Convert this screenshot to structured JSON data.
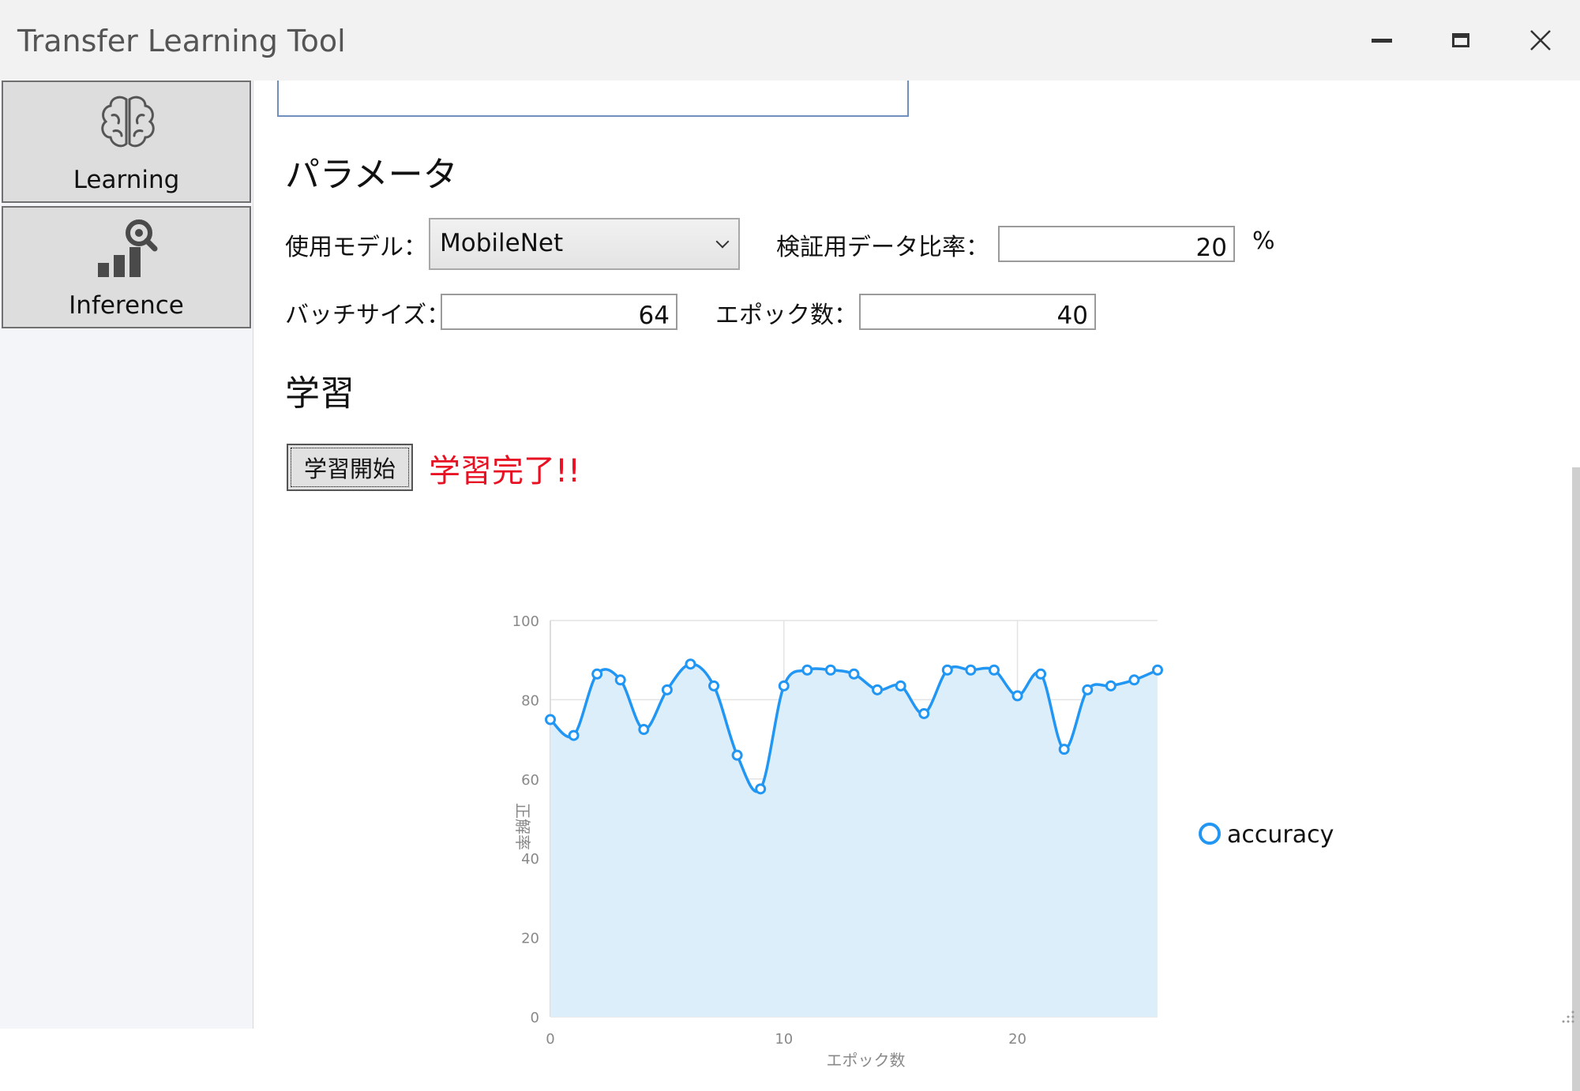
{
  "window": {
    "title": "Transfer Learning Tool"
  },
  "sidebar": {
    "items": [
      {
        "label": "Learning",
        "icon": "brain-icon"
      },
      {
        "label": "Inference",
        "icon": "chart-search-icon"
      }
    ]
  },
  "parameters": {
    "heading": "パラメータ",
    "model_label": "使用モデル：",
    "model_value": "MobileNet",
    "validation_ratio_label": "検証用データ比率：",
    "validation_ratio_value": "20",
    "validation_ratio_unit": "%",
    "batch_size_label": "バッチサイズ：",
    "batch_size_value": "64",
    "epochs_label": "エポック数：",
    "epochs_value": "40"
  },
  "learning": {
    "heading": "学習",
    "start_button": "学習開始",
    "status": "学習完了!!"
  },
  "colors": {
    "accent": "#2196f3",
    "fill": "#ddeefb",
    "status": "#e81123"
  },
  "chart_data": {
    "type": "area",
    "xlabel": "エポック数",
    "ylabel": "正解率",
    "xlim": [
      0,
      26
    ],
    "ylim": [
      0,
      100
    ],
    "x_ticks": [
      0,
      10,
      20
    ],
    "y_ticks": [
      0,
      20,
      40,
      60,
      80,
      100
    ],
    "legend_position": "right",
    "grid": true,
    "series": [
      {
        "name": "accuracy",
        "x": [
          0,
          1,
          2,
          3,
          4,
          5,
          6,
          7,
          8,
          9,
          10,
          11,
          12,
          13,
          14,
          15,
          16,
          17,
          18,
          19,
          20,
          21,
          22,
          23,
          24,
          25,
          26
        ],
        "values": [
          75,
          71,
          86.5,
          85,
          72.5,
          82.5,
          89,
          83.5,
          66,
          57.5,
          83.5,
          87.5,
          87.5,
          86.5,
          82.5,
          83.5,
          76.5,
          87.5,
          87.5,
          87.5,
          81,
          86.5,
          67.5,
          82.5,
          83.5,
          85,
          87.5
        ]
      }
    ]
  }
}
